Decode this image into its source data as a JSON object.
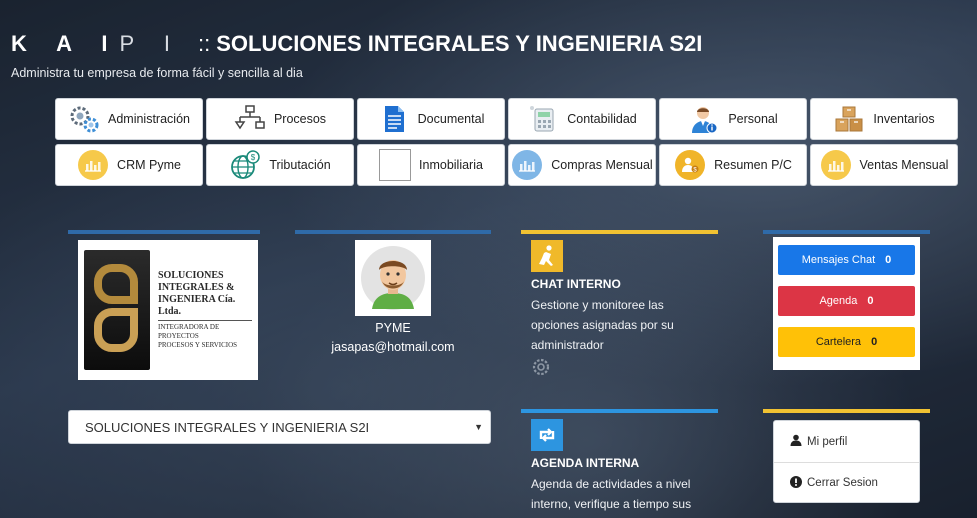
{
  "header": {
    "logo_bold": "K A I",
    "logo_thin": "P I",
    "separator": "::",
    "company_title": "SOLUCIONES INTEGRALES Y INGENIERIA S2I",
    "subtitle": "Administra tu empresa de forma fácil y sencilla al dia"
  },
  "menu": [
    {
      "label": "Administración",
      "icon": "gears-icon"
    },
    {
      "label": "Procesos",
      "icon": "flowchart-icon"
    },
    {
      "label": "Documental",
      "icon": "document-icon"
    },
    {
      "label": "Contabilidad",
      "icon": "calculator-icon"
    },
    {
      "label": "Personal",
      "icon": "employee-icon"
    },
    {
      "label": "Inventarios",
      "icon": "boxes-icon"
    },
    {
      "label": "CRM Pyme",
      "icon": "bar-chart-icon"
    },
    {
      "label": "Tributación",
      "icon": "globe-money-icon"
    },
    {
      "label": "Inmobiliaria",
      "icon": "broken-image-icon"
    },
    {
      "label": "Compras Mensual",
      "icon": "bar-chart-blue-icon"
    },
    {
      "label": "Resumen P/C",
      "icon": "user-money-icon"
    },
    {
      "label": "Ventas Mensual",
      "icon": "bar-chart-icon"
    }
  ],
  "company_logo": {
    "name_line1": "SOLUCIONES",
    "name_line2": "INTEGRALES &",
    "name_line3": "INGENIERA Cía. Ltda.",
    "tagline1": "INTEGRADORA DE PROYECTOS",
    "tagline2": "PROCESOS Y SERVICIOS"
  },
  "user": {
    "role": "PYME",
    "email": "jasapas@hotmail.com"
  },
  "company_select": {
    "value": "SOLUCIONES INTEGRALES Y INGENIERIA S2I"
  },
  "chat": {
    "title": "CHAT INTERNO",
    "description": "Gestione y monitoree las opciones asignadas por su administrador"
  },
  "agenda": {
    "title": "AGENDA INTERNA",
    "description": "Agenda de actividades a nivel interno, verifique a tiempo sus"
  },
  "messages": {
    "chat_label": "Mensajes Chat",
    "chat_count": "0",
    "agenda_label": "Agenda",
    "agenda_count": "0",
    "cartelera_label": "Cartelera",
    "cartelera_count": "0"
  },
  "profile": {
    "my_profile": "Mi perfil",
    "logout": "Cerrar Sesion"
  },
  "colors": {
    "chat_button": "#1877e8",
    "agenda_button": "#dc3545",
    "cartelera_button": "#ffc107",
    "accent_yellow": "#f1c232",
    "accent_blue": "#2d95e0"
  }
}
